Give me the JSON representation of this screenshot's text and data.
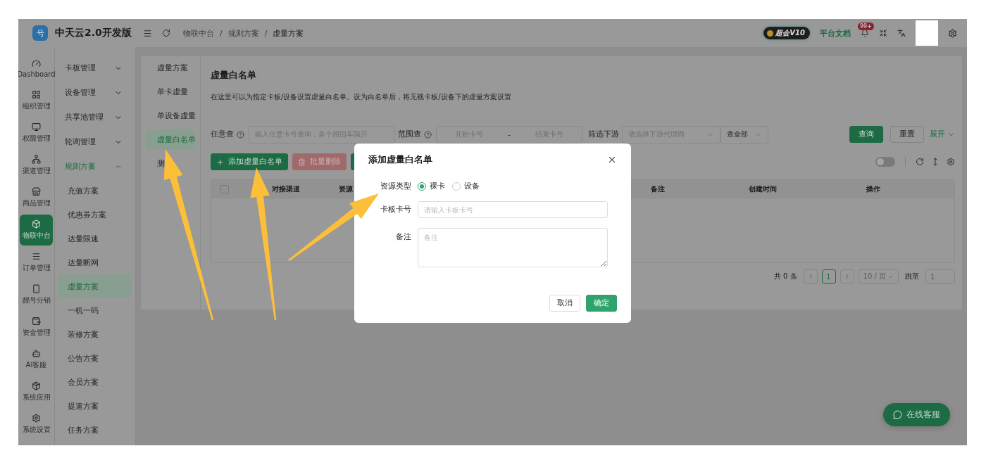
{
  "app": {
    "logo_glyph": "号",
    "name": "中天云2.0开发版"
  },
  "breadcrumb": {
    "items": [
      "物联中台",
      "规则方案",
      "虚量方案"
    ],
    "separators": [
      "/",
      "/"
    ]
  },
  "header": {
    "vip_badge": "超会V10",
    "docs_link": "平台文档",
    "notifications": "99+"
  },
  "rail": [
    {
      "label": "Dashboard",
      "selected": false
    },
    {
      "label": "组织管理",
      "selected": false
    },
    {
      "label": "权限管理",
      "selected": false
    },
    {
      "label": "渠道管理",
      "selected": false
    },
    {
      "label": "商品管理",
      "selected": false
    },
    {
      "label": "物联中台",
      "selected": true
    },
    {
      "label": "订单管理",
      "selected": false
    },
    {
      "label": "靓号分销",
      "selected": false
    },
    {
      "label": "资金管理",
      "selected": false
    },
    {
      "label": "AI客服",
      "selected": false
    },
    {
      "label": "系统应用",
      "selected": false
    },
    {
      "label": "系统设置",
      "selected": false
    }
  ],
  "menu": [
    {
      "label": "卡板管理",
      "expanded": false
    },
    {
      "label": "设备管理",
      "expanded": false
    },
    {
      "label": "共享池管理",
      "expanded": false
    },
    {
      "label": "轮询管理",
      "expanded": false
    },
    {
      "label": "规则方案",
      "expanded": true,
      "children": [
        {
          "label": "充值方案",
          "selected": false
        },
        {
          "label": "优惠券方案",
          "selected": false
        },
        {
          "label": "达量限速",
          "selected": false
        },
        {
          "label": "达量断网",
          "selected": false
        },
        {
          "label": "虚量方案",
          "selected": true
        },
        {
          "label": "一机一码",
          "selected": false
        },
        {
          "label": "装修方案",
          "selected": false
        },
        {
          "label": "公告方案",
          "selected": false
        },
        {
          "label": "会员方案",
          "selected": false
        },
        {
          "label": "提速方案",
          "selected": false
        },
        {
          "label": "任务方案",
          "selected": false
        }
      ]
    }
  ],
  "sub_tabs": [
    {
      "label": "虚量方案",
      "selected": false
    },
    {
      "label": "单卡虚量",
      "selected": false
    },
    {
      "label": "单设备虚量",
      "selected": false
    },
    {
      "label": "虚量白名单",
      "selected": true
    },
    {
      "label": "测",
      "selected": false
    }
  ],
  "page": {
    "title": "虚量白名单",
    "description": "在这里可以为指定卡板/设备设置虚量白名单。设为白名单后，将无视卡板/设备下的虚量方案设置"
  },
  "filters": {
    "any_label": "任意查",
    "any_placeholder": "输入任意卡号查询，多个用回车隔开",
    "range_label": "范围查",
    "range_start_placeholder": "开始卡号",
    "range_separator": "-",
    "range_end_placeholder": "结束卡号",
    "downstream_label": "筛选下游",
    "downstream_placeholder": "请选择下游代理商",
    "scope_value": "查全部",
    "search_button": "查询",
    "reset_button": "重置",
    "expand_link": "展开"
  },
  "actions": [
    {
      "label": "添加虚量白名单",
      "kind": "add"
    },
    {
      "label": "批量删除",
      "kind": "delete"
    },
    {
      "kind": "plain"
    }
  ],
  "table_toolbar": {
    "toggle_on": false
  },
  "table": {
    "select_all_checked": false,
    "columns": [
      "对接渠道",
      "资源",
      "备注",
      "创建时间",
      "操作"
    ]
  },
  "pagination": {
    "total": "共 0 条",
    "current": "1",
    "page_size": "10 / 页",
    "jump_label": "跳至",
    "jump_value": "1"
  },
  "modal": {
    "title": "添加虚量白名单",
    "fields": [
      {
        "kind": "radio",
        "label": "资源类型",
        "options": [
          {
            "label": "裸卡",
            "selected": true
          },
          {
            "label": "设备",
            "selected": false
          }
        ]
      },
      {
        "kind": "input",
        "label": "卡板卡号",
        "placeholder": "请输入卡板卡号"
      },
      {
        "kind": "textarea",
        "label": "备注",
        "placeholder": "备注"
      }
    ],
    "buttons": [
      {
        "label": "取消",
        "kind": "default"
      },
      {
        "label": "确定",
        "kind": "primary"
      }
    ]
  },
  "chat_button": {
    "label": "在线客服"
  }
}
